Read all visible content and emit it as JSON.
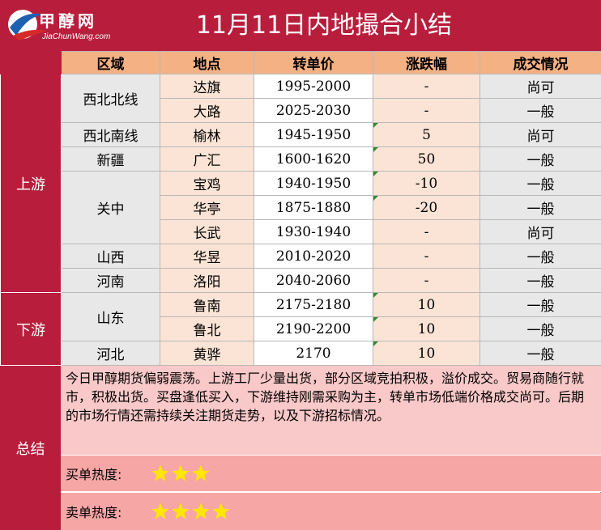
{
  "logo": {
    "name": "甲醇网",
    "url": "JiaChunWang.com"
  },
  "title": "11月11日内地撮合小结",
  "headers": [
    "区域",
    "地点",
    "转单价",
    "涨跌幅",
    "成交情况"
  ],
  "sections": {
    "upstream": "上游",
    "downstream": "下游",
    "summary": "总结"
  },
  "regions": [
    "西北北线",
    "西北南线",
    "新疆",
    "关中",
    "山西",
    "河南",
    "山东",
    "河北"
  ],
  "rows": [
    {
      "location": "达旗",
      "price": "1995-2000",
      "change": "-",
      "deal": "尚可"
    },
    {
      "location": "大路",
      "price": "2025-2030",
      "change": "-",
      "deal": "一般"
    },
    {
      "location": "榆林",
      "price": "1945-1950",
      "change": "5",
      "deal": "尚可"
    },
    {
      "location": "广汇",
      "price": "1600-1620",
      "change": "50",
      "deal": "一般"
    },
    {
      "location": "宝鸡",
      "price": "1940-1950",
      "change": "-10",
      "deal": "一般"
    },
    {
      "location": "华亭",
      "price": "1875-1880",
      "change": "-20",
      "deal": "一般"
    },
    {
      "location": "长武",
      "price": "1930-1940",
      "change": "-",
      "deal": "尚可"
    },
    {
      "location": "华昱",
      "price": "2010-2020",
      "change": "-",
      "deal": "一般"
    },
    {
      "location": "洛阳",
      "price": "2040-2060",
      "change": "-",
      "deal": "一般"
    },
    {
      "location": "鲁南",
      "price": "2175-2180",
      "change": "10",
      "deal": "一般"
    },
    {
      "location": "鲁北",
      "price": "2190-2200",
      "change": "10",
      "deal": "一般"
    },
    {
      "location": "黄骅",
      "price": "2170",
      "change": "10",
      "deal": "一般"
    }
  ],
  "summary_text": "今日甲醇期货偏弱震荡。上游工厂少量出货，部分区域竞拍积极，溢价成交。贸易商随行就市，积极出货。买盘逢低买入，下游维持刚需采购为主，转单市场低端价格成交尚可。后期的市场行情还需持续关注期货走势，以及下游招标情况。",
  "heat": {
    "buy_label": "买单热度:",
    "buy_stars": 3,
    "sell_label": "卖单热度:",
    "sell_stars": 4,
    "star_color": "#ffe600"
  }
}
